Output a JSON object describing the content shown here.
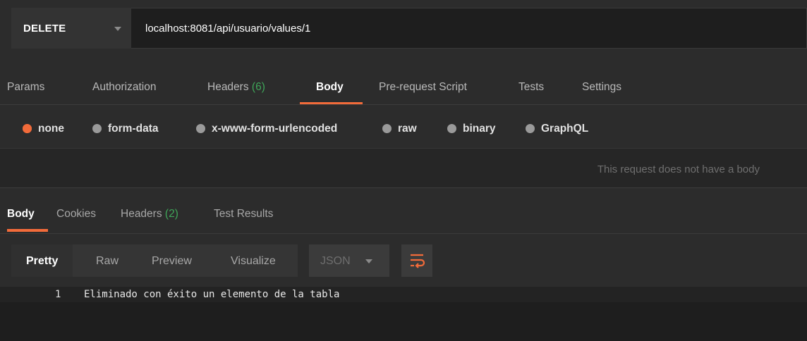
{
  "request": {
    "method": "DELETE",
    "url": "localhost:8081/api/usuario/values/1"
  },
  "request_tabs": {
    "params": "Params",
    "authorization": "Authorization",
    "headers": "Headers",
    "headers_count": "(6)",
    "body": "Body",
    "prerequest": "Pre-request Script",
    "tests": "Tests",
    "settings": "Settings",
    "active": "Body"
  },
  "body_types": {
    "none": "none",
    "form_data": "form-data",
    "urlencoded": "x-www-form-urlencoded",
    "raw": "raw",
    "binary": "binary",
    "graphql": "GraphQL",
    "selected": "none"
  },
  "no_body_message": "This request does not have a body",
  "response_tabs": {
    "body": "Body",
    "cookies": "Cookies",
    "headers": "Headers",
    "headers_count": "(2)",
    "test_results": "Test Results",
    "active": "Body"
  },
  "response_toolbar": {
    "pretty": "Pretty",
    "raw": "Raw",
    "preview": "Preview",
    "visualize": "Visualize",
    "format": "JSON",
    "active": "Pretty",
    "wrap_icon": "wrap-lines-icon"
  },
  "response_body": {
    "lines": [
      {
        "number": "1",
        "text": "Eliminado con éxito un elemento de la tabla"
      }
    ]
  },
  "colors": {
    "accent": "#f26b3a",
    "count_green": "#3fa659",
    "background": "#2c2c2c"
  }
}
